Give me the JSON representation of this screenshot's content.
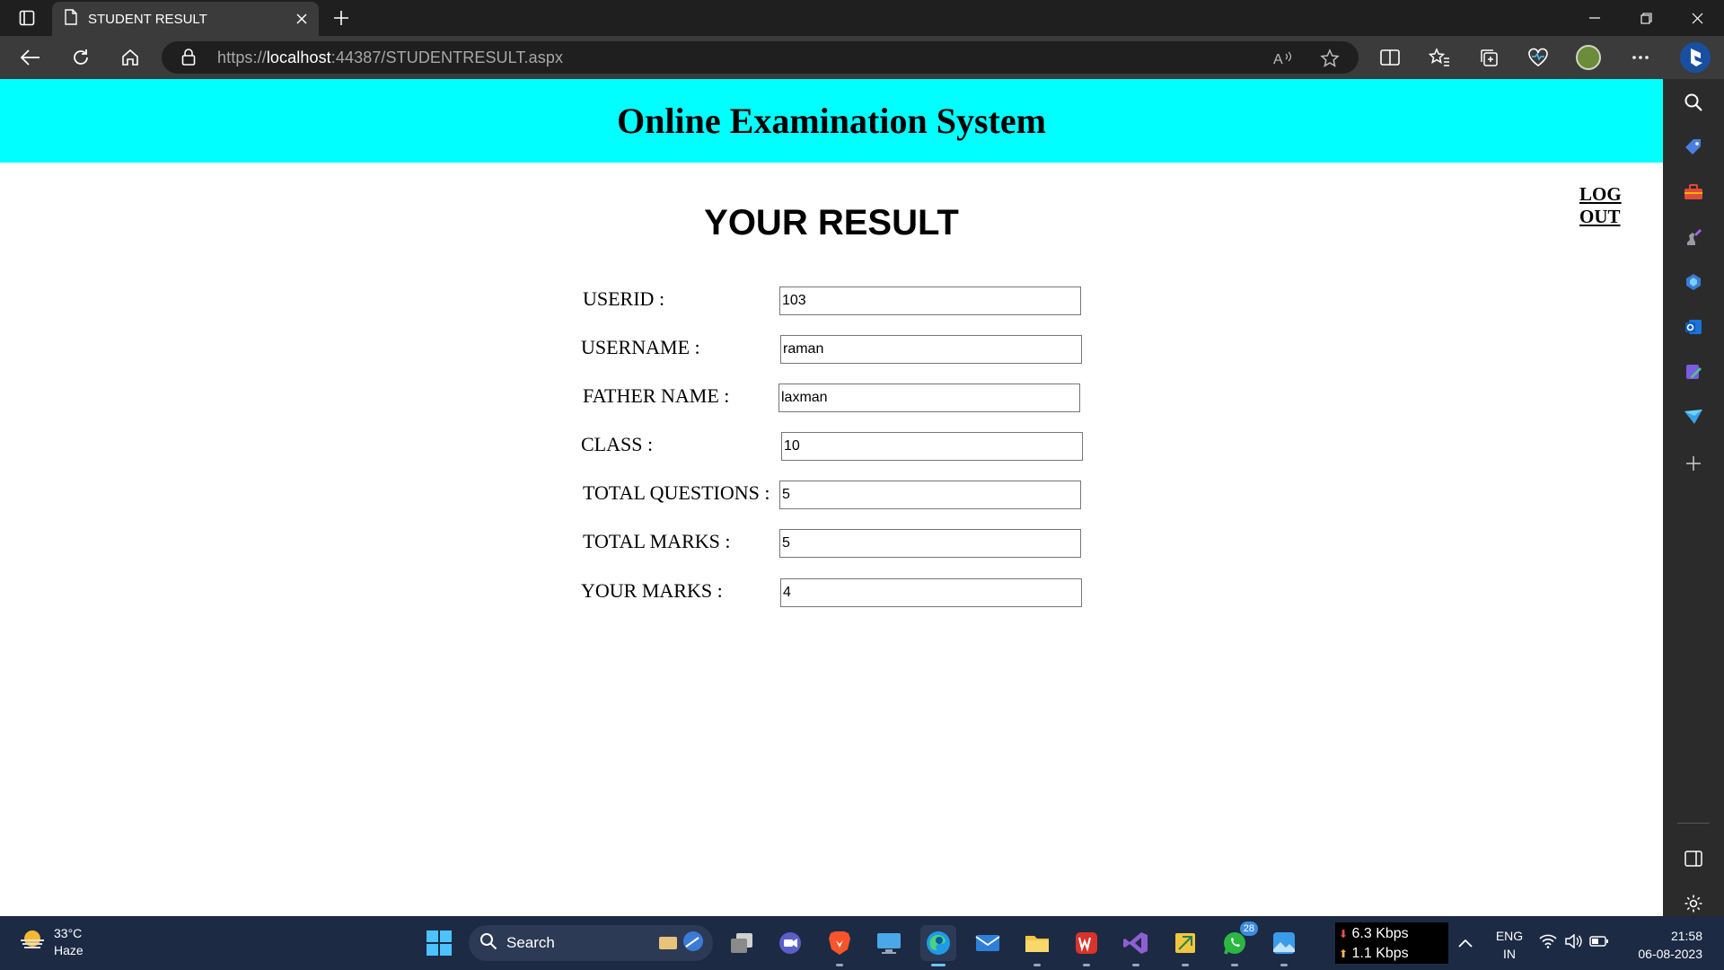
{
  "browser": {
    "tab_title": "STUDENT RESULT",
    "url_prefix": "https://",
    "url_host": "localhost",
    "url_rest": ":44387/STUDENTRESULT.aspx"
  },
  "page": {
    "banner_title": "Online Examination System",
    "logout_label": "LOG OUT",
    "heading": "YOUR RESULT",
    "fields": [
      {
        "label": "USERID :",
        "value": "103"
      },
      {
        "label": "USERNAME :",
        "value": "raman"
      },
      {
        "label": "FATHER NAME :",
        "value": "laxman"
      },
      {
        "label": "CLASS :",
        "value": "10"
      },
      {
        "label": "TOTAL QUESTIONS :",
        "value": "5"
      },
      {
        "label": "TOTAL MARKS :",
        "value": "5"
      },
      {
        "label": "YOUR MARKS :",
        "value": "4"
      }
    ]
  },
  "taskbar": {
    "weather_temp": "33°C",
    "weather_desc": "Haze",
    "search_label": "Search",
    "whatsapp_badge": "28",
    "net_down": "6.3 Kbps",
    "net_up": "1.1 Kbps",
    "lang_line1": "ENG",
    "lang_line2": "IN",
    "time": "21:58",
    "date": "06-08-2023"
  },
  "colors": {
    "banner": "#00ffff",
    "tabstrip": "#1f1f1f",
    "toolbar": "#3b3b3b",
    "taskbar": "#1c2a44"
  }
}
